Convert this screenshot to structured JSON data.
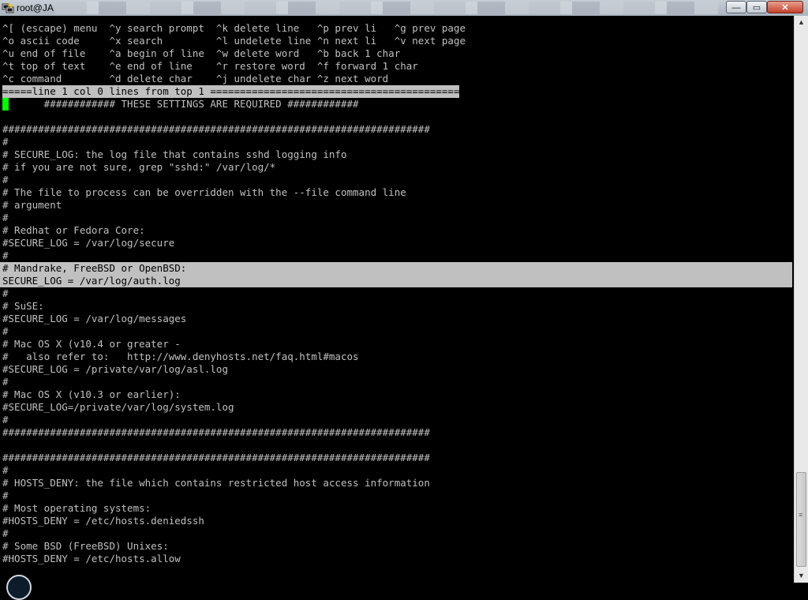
{
  "window": {
    "title": "root@JA",
    "minimize_glyph": "—",
    "maximize_glyph": "▭",
    "close_glyph": "✕"
  },
  "terminal": {
    "lines": [
      "^[ (escape) menu  ^y search prompt  ^k delete line   ^p prev li   ^g prev page",
      "^o ascii code     ^x search         ^l undelete line ^n next li   ^v next page",
      "^u end of file    ^a begin of line  ^w delete word   ^b back 1 char",
      "^t top of text    ^e end of line    ^r restore word  ^f forward 1 char",
      "^c command        ^d delete char    ^j undelete char ^z next word",
      "=====line 1 col 0 lines from top 1 ==========================================",
      "       ############ THESE SETTINGS ARE REQUIRED ############",
      "",
      "########################################################################",
      "#",
      "# SECURE_LOG: the log file that contains sshd logging info",
      "# if you are not sure, grep \"sshd:\" /var/log/*",
      "#",
      "# The file to process can be overridden with the --file command line",
      "# argument",
      "#",
      "# Redhat or Fedora Core:",
      "#SECURE_LOG = /var/log/secure",
      "#",
      "# Mandrake, FreeBSD or OpenBSD:",
      "SECURE_LOG = /var/log/auth.log",
      "#",
      "# SuSE:",
      "#SECURE_LOG = /var/log/messages",
      "#",
      "# Mac OS X (v10.4 or greater -",
      "#   also refer to:   http://www.denyhosts.net/faq.html#macos",
      "#SECURE_LOG = /private/var/log/asl.log",
      "#",
      "# Mac OS X (v10.3 or earlier):",
      "#SECURE_LOG=/private/var/log/system.log",
      "#",
      "########################################################################",
      "",
      "########################################################################",
      "#",
      "# HOSTS_DENY: the file which contains restricted host access information",
      "#",
      "# Most operating systems:",
      "#HOSTS_DENY = /etc/hosts.deniedssh",
      "#",
      "# Some BSD (FreeBSD) Unixes:",
      "#HOSTS_DENY = /etc/hosts.allow"
    ]
  },
  "colors": {
    "background": "#000000",
    "text": "#c0c0c0",
    "highlight": "#c0c0c0",
    "cursor": "#00ff00"
  },
  "icons": {
    "app": "putty-icon",
    "scroll_up": "arrow-up-icon",
    "scroll_down": "arrow-down-icon",
    "grip": "grip-icon"
  }
}
